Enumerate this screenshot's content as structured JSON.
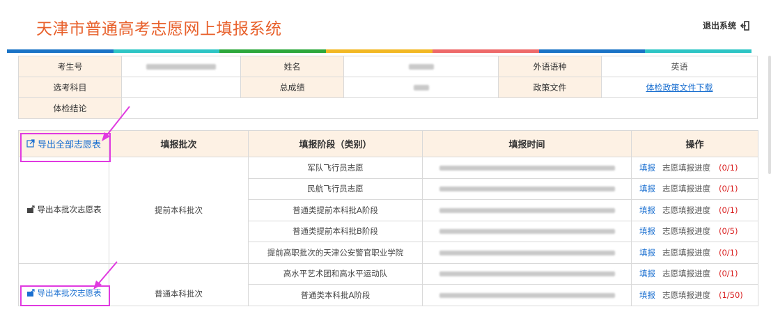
{
  "header": {
    "title": "天津市普通高考志愿网上填报系统",
    "logout_label": "退出系统"
  },
  "color_bar": [
    "#1a73c6",
    "#2ec5c5",
    "#2da83c",
    "#f2b824",
    "#ee6a6a",
    "#1a73c6",
    "#2ec5c5"
  ],
  "info": {
    "exam_no_label": "考生号",
    "name_label": "姓名",
    "language_label": "外语语种",
    "language_value": "英语",
    "subjects_label": "选考科目",
    "total_label": "总成绩",
    "policy_label": "政策文件",
    "policy_link": "体检政策文件下载",
    "health_label": "体检结论"
  },
  "table": {
    "export_all": "导出全部志愿表",
    "col_batch": "填报批次",
    "col_stage": "填报阶段（类别）",
    "col_time": "填报时间",
    "col_ops": "操作",
    "export_batch": "导出本批次志愿表",
    "batch1": "提前本科批次",
    "batch2": "普通本科批次",
    "fill_label": "填报",
    "progress_label": "志愿填报进度",
    "rows": [
      {
        "stage": "军队飞行员志愿",
        "count": "(0/1)"
      },
      {
        "stage": "民航飞行员志愿",
        "count": "(0/1)"
      },
      {
        "stage": "普通类提前本科批A阶段",
        "count": "(0/1)"
      },
      {
        "stage": "普通类提前本科批B阶段",
        "count": "(0/5)"
      },
      {
        "stage": "提前高职批次的天津公安警官职业学院",
        "count": "(0/1)"
      },
      {
        "stage": "高水平艺术团和高水平运动队",
        "count": "(0/1)"
      },
      {
        "stage": "普通类本科批A阶段",
        "count": "(1/50)"
      }
    ]
  }
}
